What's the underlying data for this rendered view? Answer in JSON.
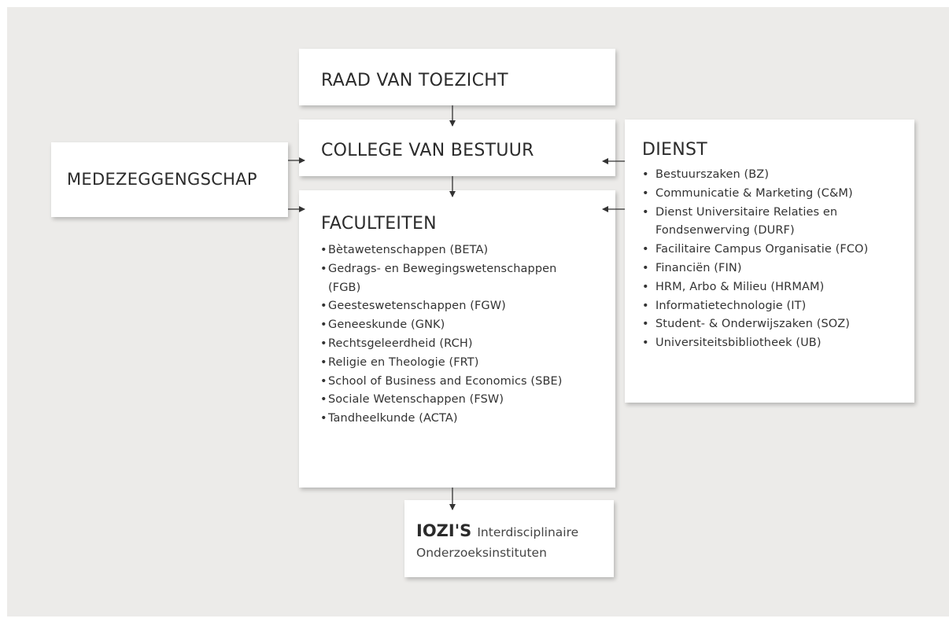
{
  "raad": {
    "title": "RAAD VAN TOEZICHT"
  },
  "college": {
    "title": "COLLEGE VAN BESTUUR"
  },
  "medezeggenschap": {
    "title": "MEDEZEGGENGSCHAP"
  },
  "faculteiten": {
    "title": "FACULTEITEN",
    "items": [
      "Bètawetenschappen (BETA)",
      "Gedrags- en Bewegingswetenschappen",
      "(FGB)",
      "Geesteswetenschappen (FGW)",
      "Geneeskunde (GNK)",
      "Rechtsgeleerdheid (RCH)",
      "Religie en Theologie (FRT)",
      "School of Business and Economics (SBE)",
      "Sociale Wetenschappen (FSW)",
      "Tandheelkunde  (ACTA)"
    ]
  },
  "dienst": {
    "title": "DIENST",
    "items": [
      "Bestuurszaken (BZ)",
      "Communicatie & Marketing (C&M)",
      "Dienst Universitaire Relaties en",
      "Fondsenwerving (DURF)",
      "Facilitaire Campus Organisatie (FCO)",
      "Financiën (FIN)",
      "HRM, Arbo & Milieu (HRMAM)",
      "Informatietechnologie (IT)",
      "Student- & Onderwijszaken (SOZ)",
      "Universiteitsbibliotheek (UB)"
    ]
  },
  "iozi": {
    "title": "IOZI'S",
    "subtitle_line1": "Interdisciplinaire",
    "subtitle_line2": "Onderzoeksinstituten"
  },
  "bullet_glyph": "•"
}
